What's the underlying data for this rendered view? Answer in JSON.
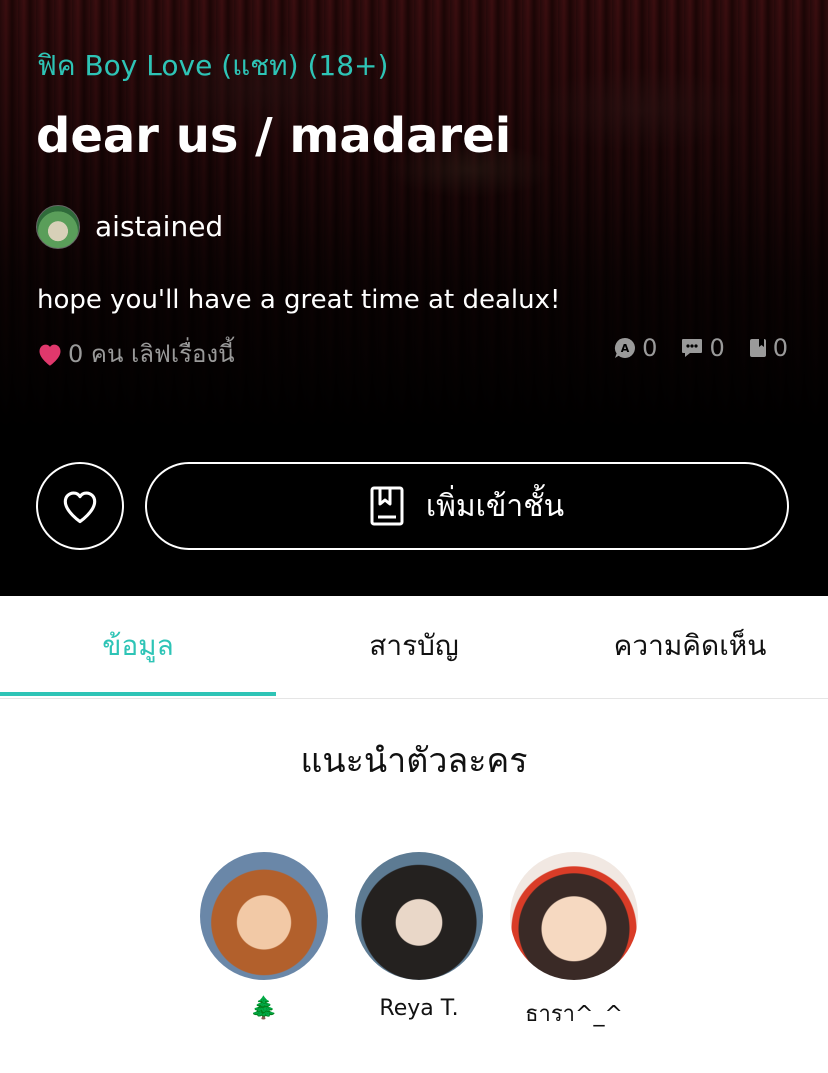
{
  "story": {
    "category": "ฟิค Boy Love (แชท) (18+)",
    "title": "dear us / madarei",
    "author": "aistained",
    "description": "hope you'll have a great time at dealux!",
    "love_text": "0 คน เลิฟเรื่องนี้",
    "stats": [
      {
        "icon": "review-icon",
        "value": "0"
      },
      {
        "icon": "comment-icon",
        "value": "0"
      },
      {
        "icon": "bookmark-icon",
        "value": "0"
      }
    ]
  },
  "actions": {
    "add_label": "เพิ่มเข้าชั้น"
  },
  "tabs": [
    {
      "label": "ข้อมูล",
      "active": true
    },
    {
      "label": "สารบัญ",
      "active": false
    },
    {
      "label": "ความคิดเห็น",
      "active": false
    }
  ],
  "characters": {
    "section_title": "แนะนำตัวละคร",
    "items": [
      {
        "name": "🌲"
      },
      {
        "name": "Reya T."
      },
      {
        "name": "ธารา^_^"
      }
    ]
  },
  "colors": {
    "accent": "#2ec4b6",
    "love": "#e0386c"
  }
}
